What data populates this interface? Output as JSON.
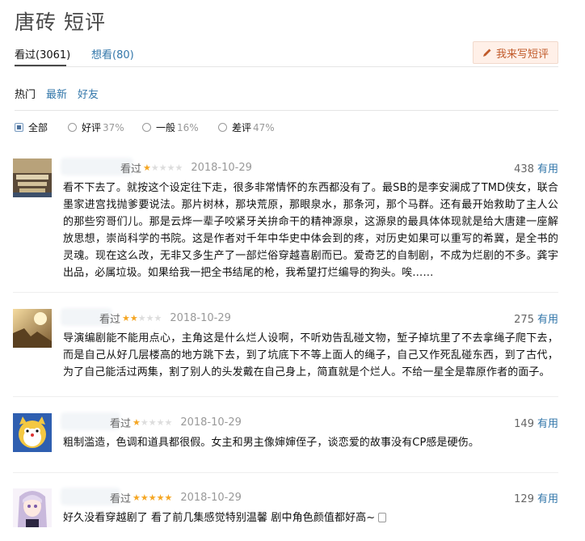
{
  "page": {
    "title": "唐砖 短评"
  },
  "tabs": [
    {
      "label": "看过(3061)"
    },
    {
      "label": "想看(80)"
    }
  ],
  "write_button": {
    "label": "我来写短评"
  },
  "sorts": [
    {
      "label": "热门"
    },
    {
      "label": "最新"
    },
    {
      "label": "好友"
    }
  ],
  "filters": [
    {
      "label": "全部",
      "pct": ""
    },
    {
      "label": "好评",
      "pct": "37%"
    },
    {
      "label": "一般",
      "pct": "16%"
    },
    {
      "label": "差评",
      "pct": "47%"
    }
  ],
  "reviews": [
    {
      "status": "看过",
      "rating": 1,
      "date": "2018-10-29",
      "votes": "438",
      "useful_label": "有用",
      "text": "看不下去了。就按这个设定往下走，很多非常情怀的东西都没有了。最SB的是李安澜成了TMD侠女，联合墨家进宫找抛爹要说法。那片树林，那块荒原，那眼泉水，那条河，那个马群。还有最开始救助了主人公的那些穷哥们儿。那是云烨一辈子咬紧牙关拚命干的精神源泉，这源泉的最具体体现就是给大唐建一座解放思想，崇尚科学的书院。这是作者对千年中华史中体会到的疼，对历史如果可以重写的希冀，是全书的灵魂。现在这么改，无非又多生产了一部烂俗穿越喜剧而已。爱奇艺的自制剧，不成为烂剧的不多。龚宇出品，必属垃圾。如果给我一把全书结尾的枪，我希望打烂编导的狗头。唉……",
      "avatar_colors": [
        "#6b5a44",
        "#c9b58f",
        "#3c4f6a"
      ]
    },
    {
      "status": "看过",
      "rating": 2,
      "date": "2018-10-29",
      "votes": "275",
      "useful_label": "有用",
      "text": "导演编剧能不能用点心，主角这是什么烂人设啊，不听劝告乱碰文物，堑子掉坑里了不去拿绳子爬下去，而是自己从好几层楼高的地方跳下去，到了坑底下不等上面人的绳子，自己又作死乱碰东西，到了古代，为了自己能活过两集，割了别人的头发戴在自己身上，简直就是个烂人。不给一星全是靠原作者的面子。",
      "avatar_colors": [
        "#d9a35a",
        "#8a6a3c",
        "#f0d9a8"
      ]
    },
    {
      "status": "看过",
      "rating": 1,
      "date": "2018-10-29",
      "votes": "149",
      "useful_label": "有用",
      "text": "粗制滥造，色调和道具都很假。女主和男主像婶婶侄子，谈恋爱的故事没有CP感是硬伤。",
      "avatar_colors": [
        "#2f5fb0",
        "#f4c842",
        "#ffffff"
      ]
    },
    {
      "status": "看过",
      "rating": 5,
      "date": "2018-10-29",
      "votes": "129",
      "useful_label": "有用",
      "text": "好久没看穿越剧了 看了前几集感觉特别温馨 剧中角色颜值都好高~",
      "avatar_colors": [
        "#e8e0f0",
        "#c9b9dc",
        "#f7f2f9"
      ]
    }
  ],
  "colors": {
    "link": "#37a",
    "star": "#f5a623",
    "button_bg": "#fff0e8",
    "button_text": "#c05a2a"
  }
}
